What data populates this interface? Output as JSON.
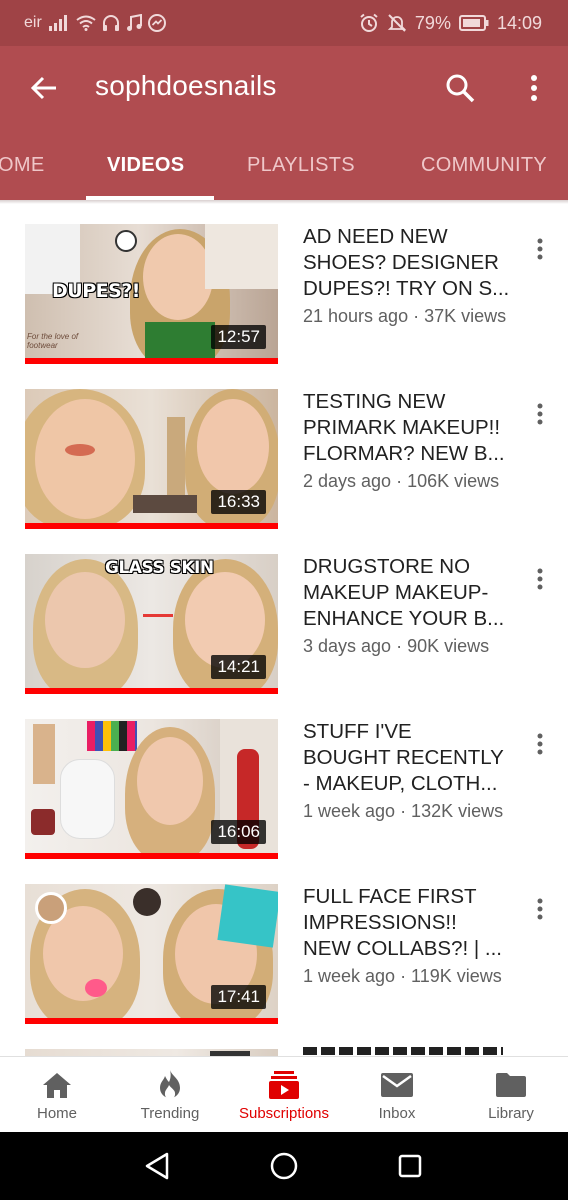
{
  "status_bar": {
    "carrier": "eir",
    "battery": "79%",
    "time": "14:09"
  },
  "app_bar": {
    "title": "sophdoesnails"
  },
  "tabs": [
    {
      "label": "OME",
      "active": false
    },
    {
      "label": "VIDEOS",
      "active": true
    },
    {
      "label": "PLAYLISTS",
      "active": false
    },
    {
      "label": "COMMUNITY",
      "active": false
    }
  ],
  "videos": [
    {
      "title_lines": [
        "AD NEED NEW",
        "SHOES? DESIGNER",
        "DUPES?! TRY ON S..."
      ],
      "meta": "21 hours ago · 37K views",
      "duration": "12:57",
      "thumb_caption": "DUPES?!",
      "thumb_caption_small": "For the love of footwear"
    },
    {
      "title_lines": [
        "TESTING NEW",
        "PRIMARK MAKEUP!!",
        "FLORMAR? NEW B..."
      ],
      "meta": "2 days ago · 106K views",
      "duration": "16:33",
      "thumb_caption": ""
    },
    {
      "title_lines": [
        "DRUGSTORE NO",
        "MAKEUP MAKEUP-",
        "ENHANCE YOUR B..."
      ],
      "meta": "3 days ago · 90K views",
      "duration": "14:21",
      "thumb_caption": "GLASS SKIN"
    },
    {
      "title_lines": [
        "STUFF I'VE",
        "BOUGHT RECENTLY",
        "- MAKEUP, CLOTH..."
      ],
      "meta": "1 week ago · 132K views",
      "duration": "16:06",
      "thumb_caption": ""
    },
    {
      "title_lines": [
        "FULL FACE FIRST",
        "IMPRESSIONS!!",
        "NEW COLLABS?!  | ..."
      ],
      "meta": "1 week ago · 119K views",
      "duration": "17:41",
      "thumb_caption": ""
    }
  ],
  "bottom_nav": [
    {
      "label": "Home",
      "icon": "home-icon",
      "active": false
    },
    {
      "label": "Trending",
      "icon": "flame-icon",
      "active": false
    },
    {
      "label": "Subscriptions",
      "icon": "subscriptions-icon",
      "active": true
    },
    {
      "label": "Inbox",
      "icon": "mail-icon",
      "active": false
    },
    {
      "label": "Library",
      "icon": "folder-icon",
      "active": false
    }
  ],
  "colors": {
    "status_bar": "#9f4346",
    "app_bar": "#b04c50",
    "accent_red": "#ff0000",
    "active_nav": "#e00000"
  }
}
